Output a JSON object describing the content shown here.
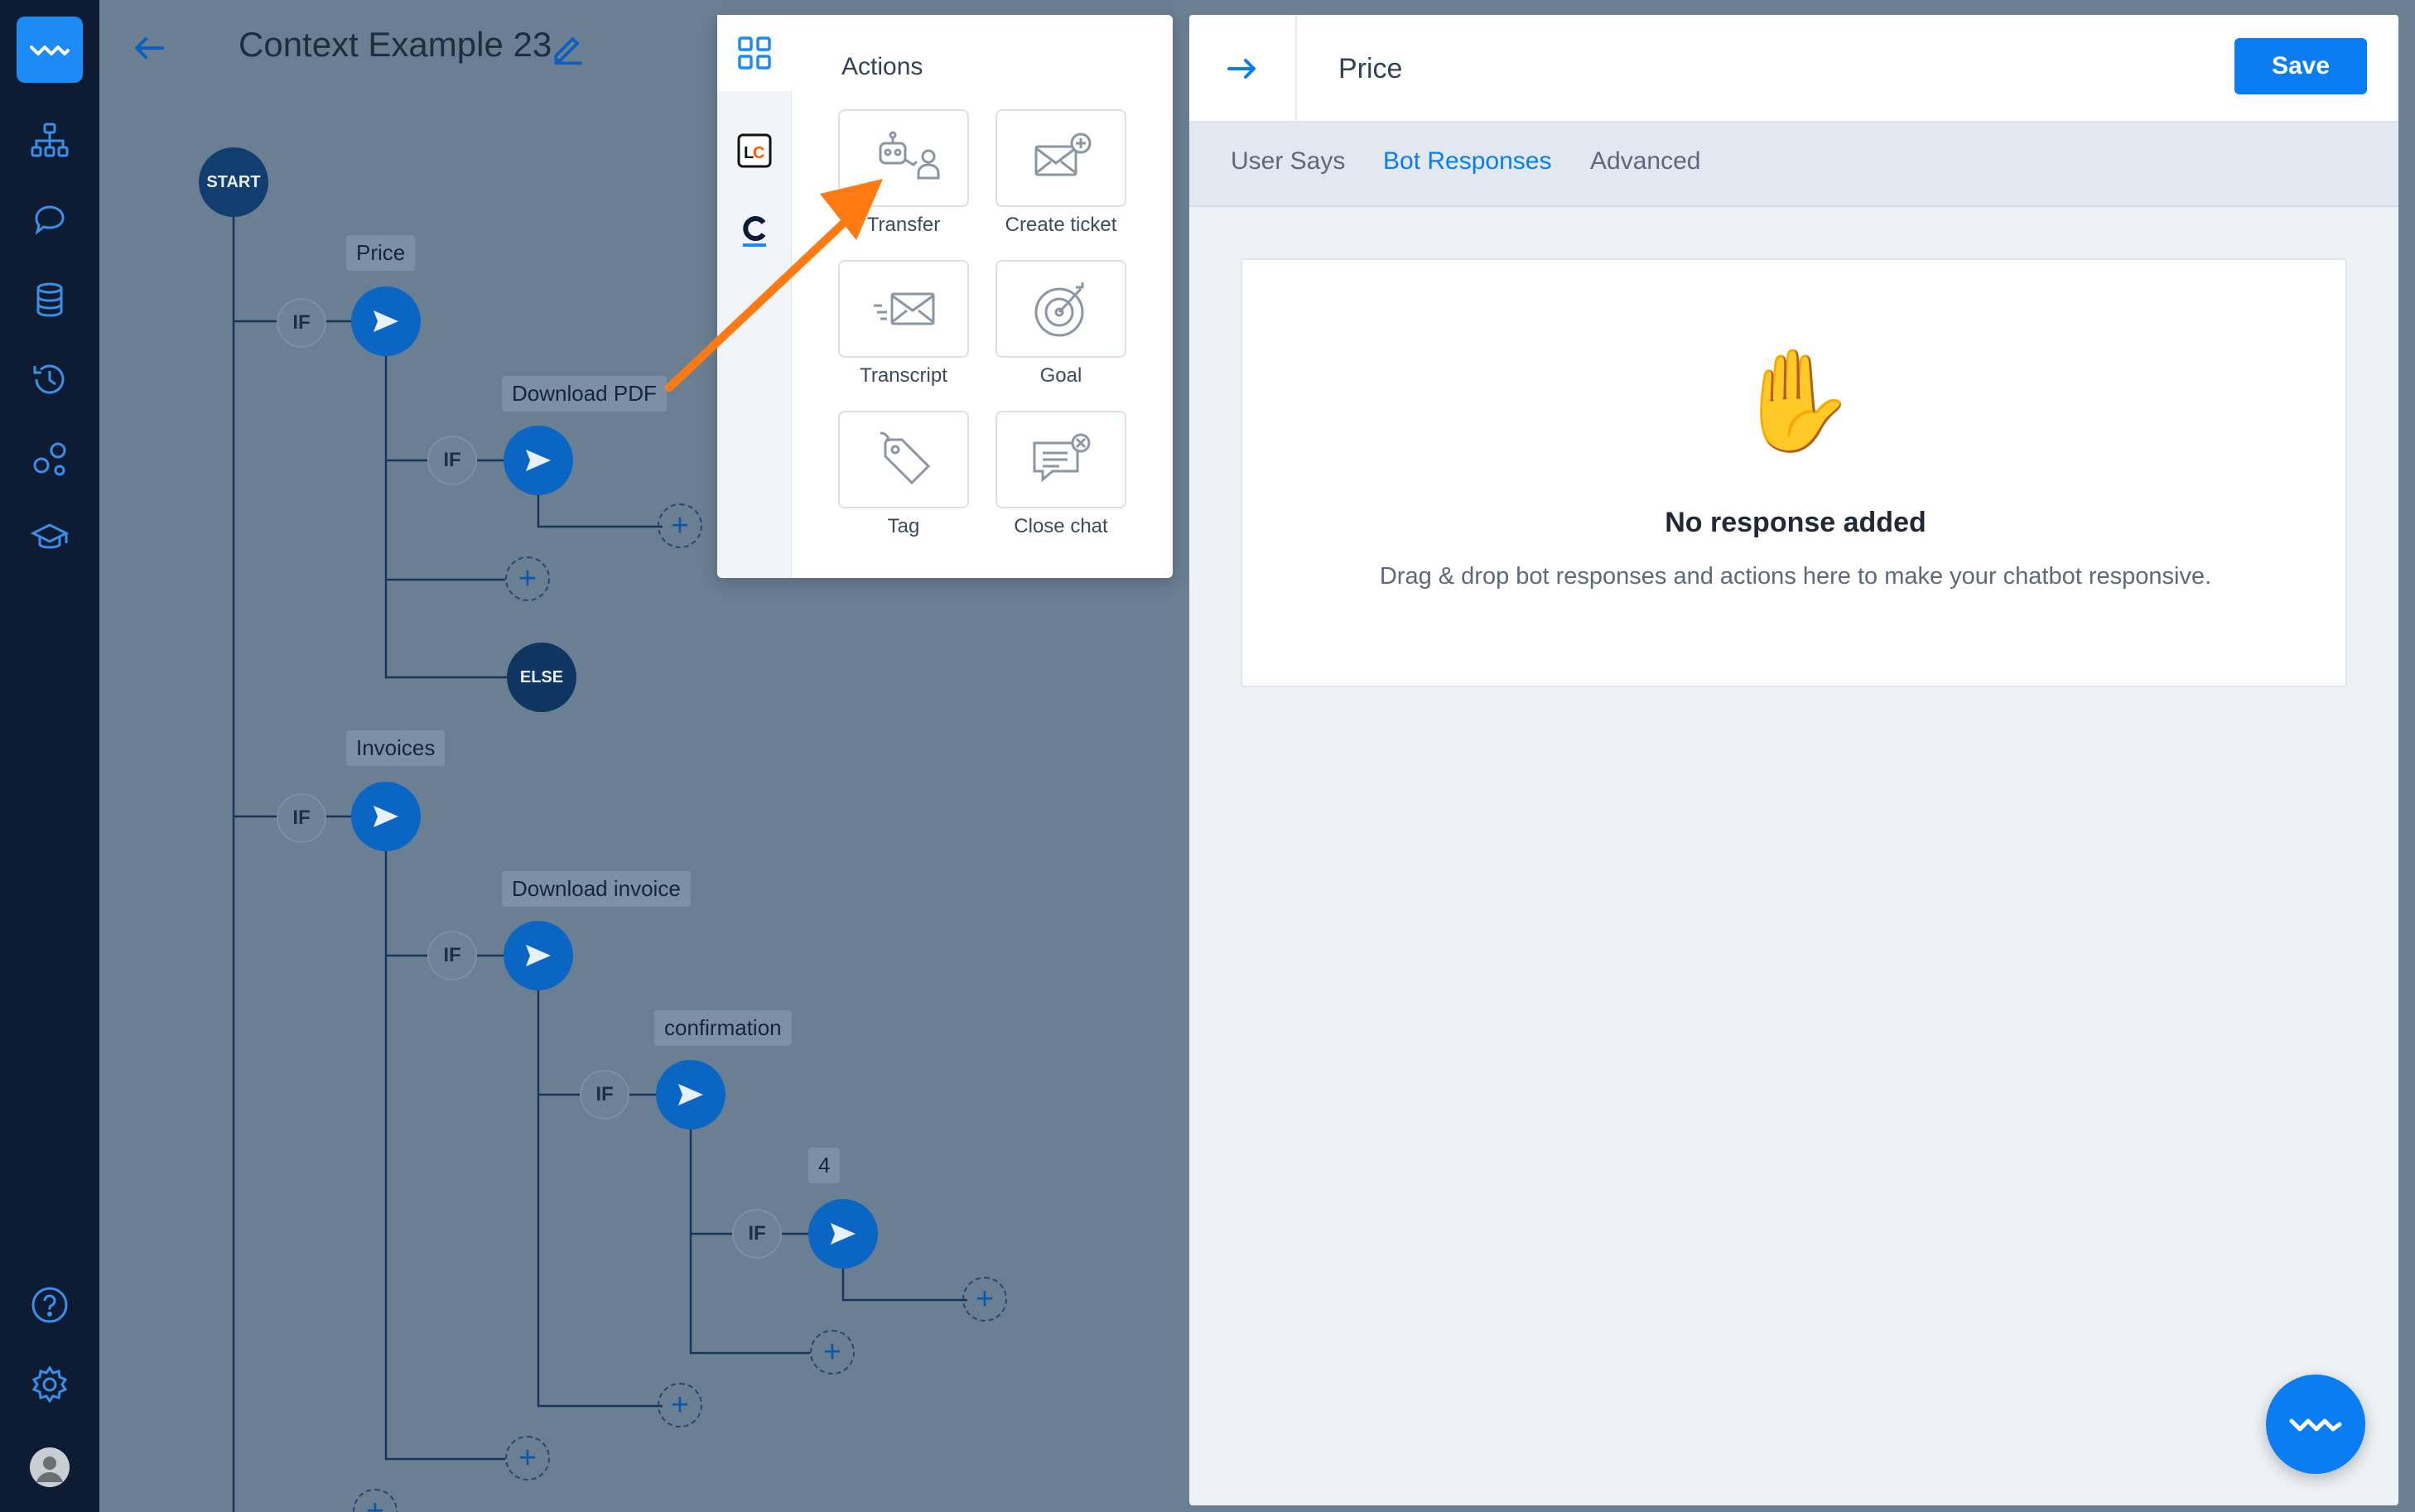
{
  "header": {
    "flow_title": "Context Example 23"
  },
  "sidebar": {
    "items": [
      {
        "icon": "bot-logo-icon"
      },
      {
        "icon": "flows-icon"
      },
      {
        "icon": "intents-icon"
      },
      {
        "icon": "database-icon"
      },
      {
        "icon": "history-icon"
      },
      {
        "icon": "integrations-icon"
      },
      {
        "icon": "academy-icon"
      },
      {
        "icon": "help-icon"
      },
      {
        "icon": "settings-icon"
      },
      {
        "icon": "avatar"
      }
    ]
  },
  "flow": {
    "start_label": "START",
    "else_label": "ELSE",
    "if_label": "IF",
    "plus_label": "+",
    "labels": {
      "price": "Price",
      "download_pdf": "Download PDF",
      "invoices": "Invoices",
      "download_invoice": "Download invoice",
      "confirmation": "confirmation",
      "four": "4"
    }
  },
  "actions_panel": {
    "title": "Actions",
    "rail_tabs": [
      "grid-icon",
      "livechat-icon",
      "chatbot-c-icon"
    ],
    "items": [
      {
        "label": "Transfer",
        "icon": "transfer-icon"
      },
      {
        "label": "Create ticket",
        "icon": "create-ticket-icon"
      },
      {
        "label": "Transcript",
        "icon": "transcript-icon"
      },
      {
        "label": "Goal",
        "icon": "goal-icon"
      },
      {
        "label": "Tag",
        "icon": "tag-icon"
      },
      {
        "label": "Close chat",
        "icon": "close-chat-icon"
      }
    ]
  },
  "right_panel": {
    "title": "Price",
    "save_label": "Save",
    "tabs": [
      {
        "label": "User Says",
        "active": false
      },
      {
        "label": "Bot Responses",
        "active": true
      },
      {
        "label": "Advanced",
        "active": false
      }
    ],
    "empty": {
      "emoji": "✋",
      "title": "No response added",
      "subtitle": "Drag & drop bot responses and actions here to make your chatbot responsive."
    }
  },
  "colors": {
    "accent": "#0a7df2",
    "sidebar": "#0e1c33",
    "canvas_overlay": "#6b7f93",
    "node_blue": "#0b66c3",
    "arrow_orange": "#ff7a12"
  }
}
